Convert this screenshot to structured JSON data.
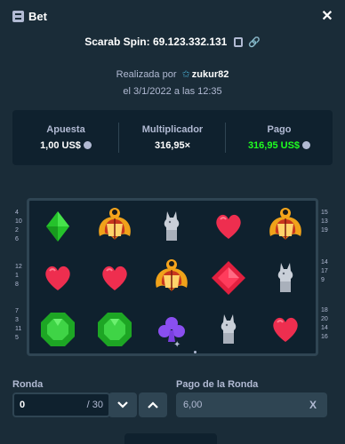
{
  "header": {
    "title": "Bet",
    "close": "✕"
  },
  "game": {
    "title": "Scarab Spin: 69.123.332.131"
  },
  "placed": {
    "prefix": "Realizada por",
    "user": "zukur82"
  },
  "date": "el 3/1/2022 a las 12:35",
  "stats": [
    {
      "label": "Apuesta",
      "value": "1,00 US$",
      "coin": true,
      "color": "#ffffff"
    },
    {
      "label": "Multiplicador",
      "value": "316,95×",
      "coin": false,
      "color": "#ffffff"
    },
    {
      "label": "Pago",
      "value": "316,95 US$",
      "coin": true,
      "color": "#1fff20"
    }
  ],
  "board": {
    "rows": [
      [
        "green-gem-icon",
        "scarab-icon",
        "jackal-statue-icon",
        "red-heart-icon",
        "scarab-icon"
      ],
      [
        "red-heart-icon",
        "red-heart-icon",
        "scarab-icon",
        "red-diamond-icon",
        "jackal-statue-icon"
      ],
      [
        "green-emerald-icon",
        "green-emerald-icon",
        "purple-club-icon",
        "jackal-statue-icon",
        "red-heart-icon"
      ]
    ],
    "left_numbers": [
      [
        "4",
        "10",
        "2",
        "6"
      ],
      [
        "12",
        "1",
        "8"
      ],
      [
        "7",
        "3",
        "11",
        "5"
      ]
    ],
    "right_numbers": [
      [
        "15",
        "13",
        "19"
      ],
      [
        "14",
        "17",
        "9"
      ],
      [
        "18",
        "20",
        "14",
        "16"
      ]
    ]
  },
  "round": {
    "label": "Ronda",
    "value": "0",
    "total": "/ 30"
  },
  "round_payout": {
    "label": "Pago de la Ronda",
    "value": "6,00",
    "clear": "X"
  },
  "colors": {
    "accent_green": "#1fff20",
    "background": "#1a2c38",
    "panel": "#0f212e",
    "border": "#2f4553"
  }
}
